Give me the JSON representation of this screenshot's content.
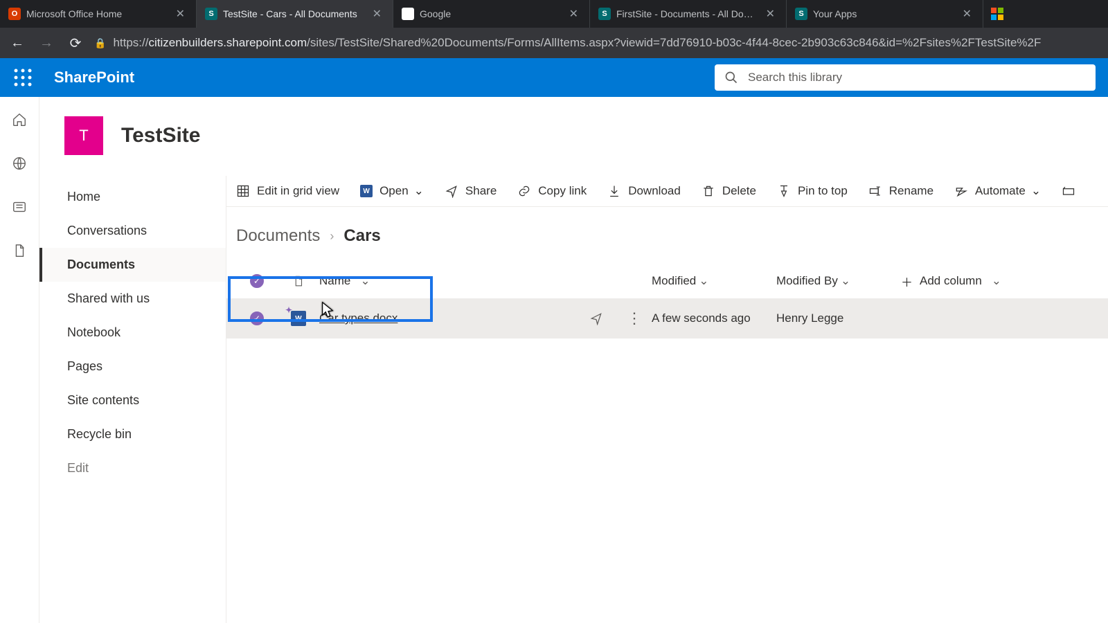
{
  "browser": {
    "tabs": [
      {
        "title": "Microsoft Office Home",
        "icon": "office"
      },
      {
        "title": "TestSite - Cars - All Documents",
        "icon": "sp",
        "active": true
      },
      {
        "title": "Google",
        "icon": "google"
      },
      {
        "title": "FirstSite - Documents - All Docu…",
        "icon": "sp"
      },
      {
        "title": "Your Apps",
        "icon": "sp"
      }
    ],
    "url_host": "citizenbuilders.sharepoint.com",
    "url_path": "/sites/TestSite/Shared%20Documents/Forms/AllItems.aspx?viewid=7dd76910-b03c-4f44-8cec-2b903c63c846&id=%2Fsites%2FTestSite%2F"
  },
  "suite": {
    "product": "SharePoint",
    "search_placeholder": "Search this library"
  },
  "site": {
    "logo_letter": "T",
    "title": "TestSite"
  },
  "nav": {
    "items": [
      "Home",
      "Conversations",
      "Documents",
      "Shared with us",
      "Notebook",
      "Pages",
      "Site contents",
      "Recycle bin",
      "Edit"
    ],
    "active_index": 2
  },
  "commands": {
    "grid": "Edit in grid view",
    "open": "Open",
    "share": "Share",
    "copy": "Copy link",
    "download": "Download",
    "delete": "Delete",
    "pin": "Pin to top",
    "rename": "Rename",
    "automate": "Automate"
  },
  "breadcrumb": {
    "parent": "Documents",
    "current": "Cars"
  },
  "columns": {
    "name": "Name",
    "modified": "Modified",
    "modifiedBy": "Modified By",
    "add": "Add column"
  },
  "rows": [
    {
      "name": "Car types.docx",
      "modified": "A few seconds ago",
      "modifiedBy": "Henry Legge",
      "selected": true
    }
  ]
}
